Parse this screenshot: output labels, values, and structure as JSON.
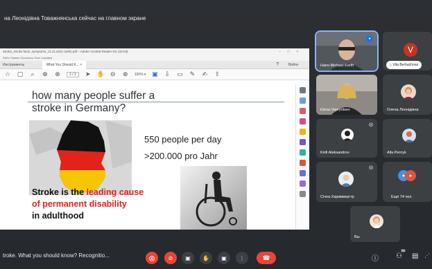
{
  "banner": "на Леонідівна Товажнянська сейчас на главном экране",
  "acrobat": {
    "title": "Stroke_Stroke facts_symptoms_12.11.2021 (web).pdf – Adobe Acrobat Reader DC (32-bit)",
    "menu": "Файл  Правка  Просмотр  Окно  Справка",
    "tabs": [
      "Инструменты",
      "What You Should K... ×"
    ],
    "help": "?",
    "signin": "Войти",
    "page": "1 / 2",
    "zoom": "100% ▾"
  },
  "slide": {
    "title_line1": "how many people suffer a",
    "title_line2": "stroke in Germany?",
    "fact1": "550 people per day",
    "fact2": ">200.000 pro Jahr",
    "stroke_prefix": "Stroke is the ",
    "stroke_highlight1": "leading cause",
    "stroke_highlight2": "of permanent disability",
    "stroke_suffix": "in adulthood"
  },
  "participants": [
    {
      "name": "Hans-Michael Kerth",
      "highlight": "#8ab4f8"
    },
    {
      "name": "Vita Berhachova",
      "initial": "V",
      "color": "#c5341f"
    },
    {
      "name": "Elena Vepryntsev"
    },
    {
      "name": "Олена Леонідівна"
    },
    {
      "name": "Kirill Aleksandrov"
    },
    {
      "name": "Alla Pernyk"
    },
    {
      "name": "Січна Харківвергтр"
    },
    {
      "name": "Ещё 74 чел."
    },
    {
      "name": "Вы"
    }
  ],
  "bottom": {
    "meeting_name": "troke. What you should know? Recognitio...",
    "participant_count": "80"
  },
  "colors": {
    "accent_red": "#ea4335",
    "meet_bg": "#202124",
    "tile_bg": "#3c4043"
  }
}
